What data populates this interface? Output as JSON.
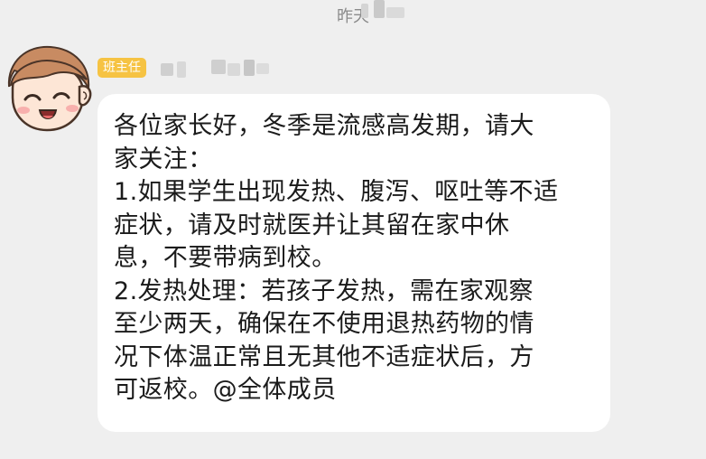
{
  "timestamp": "昨天",
  "sender": {
    "role_badge": "班主任",
    "avatar_icon": "cartoon-boy-avatar-icon",
    "name_redacted": true
  },
  "colors": {
    "background": "#efefef",
    "bubble": "#ffffff",
    "badge": "#f6c343",
    "text": "#1b1b1b",
    "timestamp": "#8a8a8a"
  },
  "message": {
    "lines": [
      "各位家长好，冬季是流感高发期，请大",
      "家关注：",
      "1.如果学生出现发热、腹泻、呕吐等不适",
      "症状，请及时就医并让其留在家中休",
      "息，不要带病到校。",
      "2.发热处理：若孩子发热，需在家观察",
      "至少两天，确保在不使用退热药物的情",
      "况下体温正常且无其他不适症状后，方",
      "可返校。@全体成员"
    ]
  }
}
